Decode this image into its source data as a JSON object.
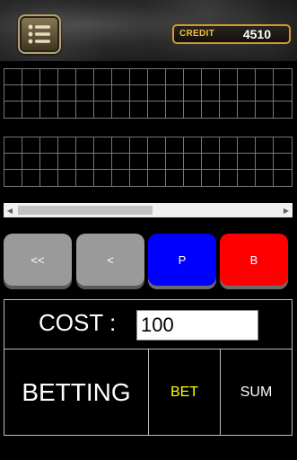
{
  "header": {
    "credit_label": "CREDIT",
    "credit_value": "4510",
    "menu_icon": "menu-list-icon"
  },
  "scrollbar": {
    "left_arrow": "◀",
    "right_arrow": "▶"
  },
  "controls": {
    "first_label": "<<",
    "prev_label": "<",
    "player_label": "P",
    "banker_label": "B"
  },
  "cost": {
    "label": "COST :",
    "value": "100"
  },
  "actions": {
    "betting_label": "BETTING",
    "bet_label": "BET",
    "sum_label": "SUM"
  },
  "colors": {
    "player": "#0000ff",
    "banker": "#ff0000",
    "bet_text": "#ffff00",
    "credit_accent": "#f0c040"
  }
}
